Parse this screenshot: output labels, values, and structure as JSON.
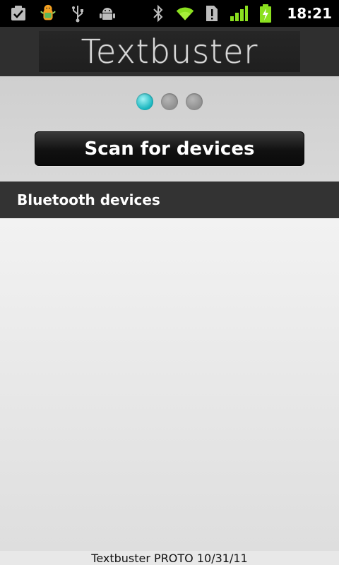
{
  "status_bar": {
    "time": "18:21",
    "left_icons": [
      "task-done-icon",
      "android-robot-icon",
      "usb-icon",
      "android-debug-icon"
    ],
    "right_icons": [
      "bluetooth-icon",
      "wifi-icon",
      "alert-sim-icon",
      "signal-icon",
      "battery-charging-icon"
    ]
  },
  "header": {
    "logo_text": "Textbuster"
  },
  "pager": {
    "current_page": 1,
    "total_pages": 3
  },
  "scan_button": {
    "label": "Scan for devices"
  },
  "section": {
    "title": "Bluetooth devices"
  },
  "devices": [],
  "footer": {
    "text": "Textbuster PROTO 10/31/11"
  },
  "colors": {
    "accent": "#1bb7c0",
    "header_bg": "#2f2f2f",
    "section_bg": "#333333"
  }
}
